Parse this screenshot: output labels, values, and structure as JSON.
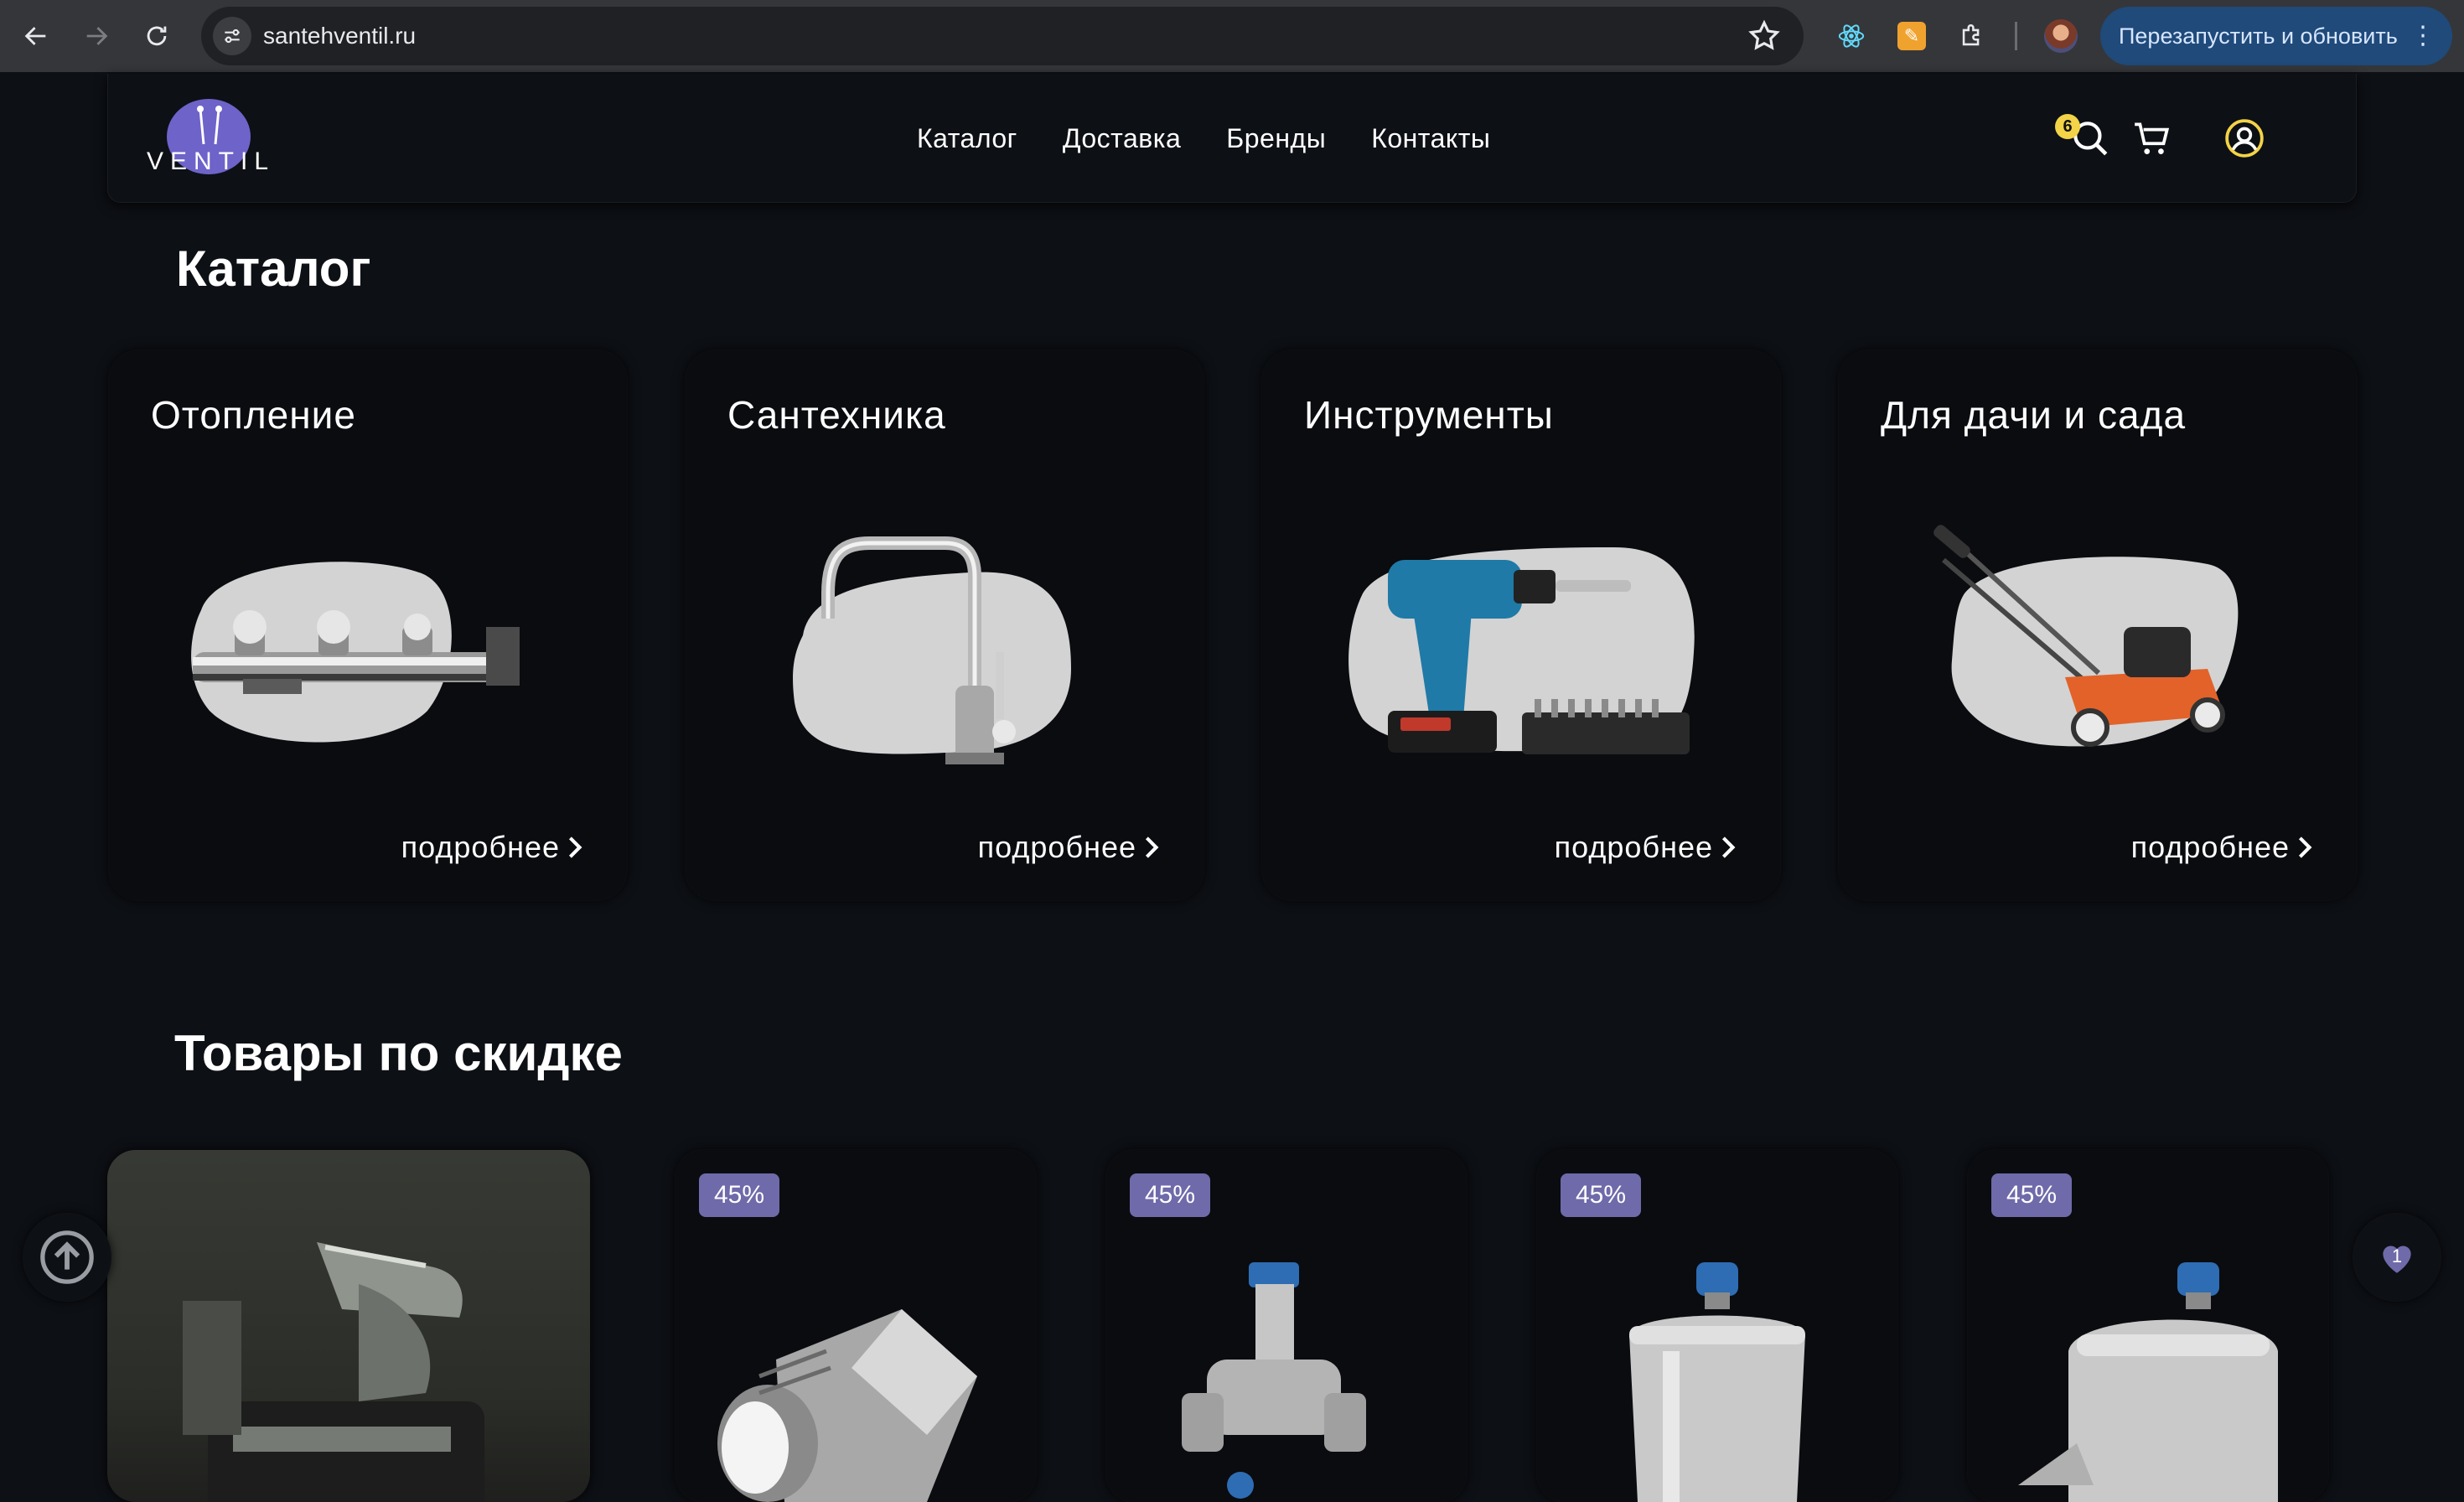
{
  "browser": {
    "url": "santehventil.ru",
    "relaunch_label": "Перезапустить и обновить"
  },
  "header": {
    "logo_text": "VENTIL",
    "nav": [
      "Каталог",
      "Доставка",
      "Бренды",
      "Контакты"
    ],
    "cart_count": "6"
  },
  "catalog": {
    "heading": "Каталог",
    "categories": [
      {
        "title": "Отопление",
        "more": "подробнее"
      },
      {
        "title": "Сантехника",
        "more": "подробнее"
      },
      {
        "title": "Инструменты",
        "more": "подробнее"
      },
      {
        "title": "Для дачи и сада",
        "more": "подробнее"
      }
    ]
  },
  "sale": {
    "heading": "Товары по скидке",
    "badges": [
      "45%",
      "45%",
      "45%",
      "45%"
    ]
  },
  "wishlist_count": "1",
  "colors": {
    "background": "#0d1015",
    "accent": "#6f6aa9",
    "badge_yellow": "#f3d347",
    "relaunch_bg": "#1f4a7a"
  }
}
